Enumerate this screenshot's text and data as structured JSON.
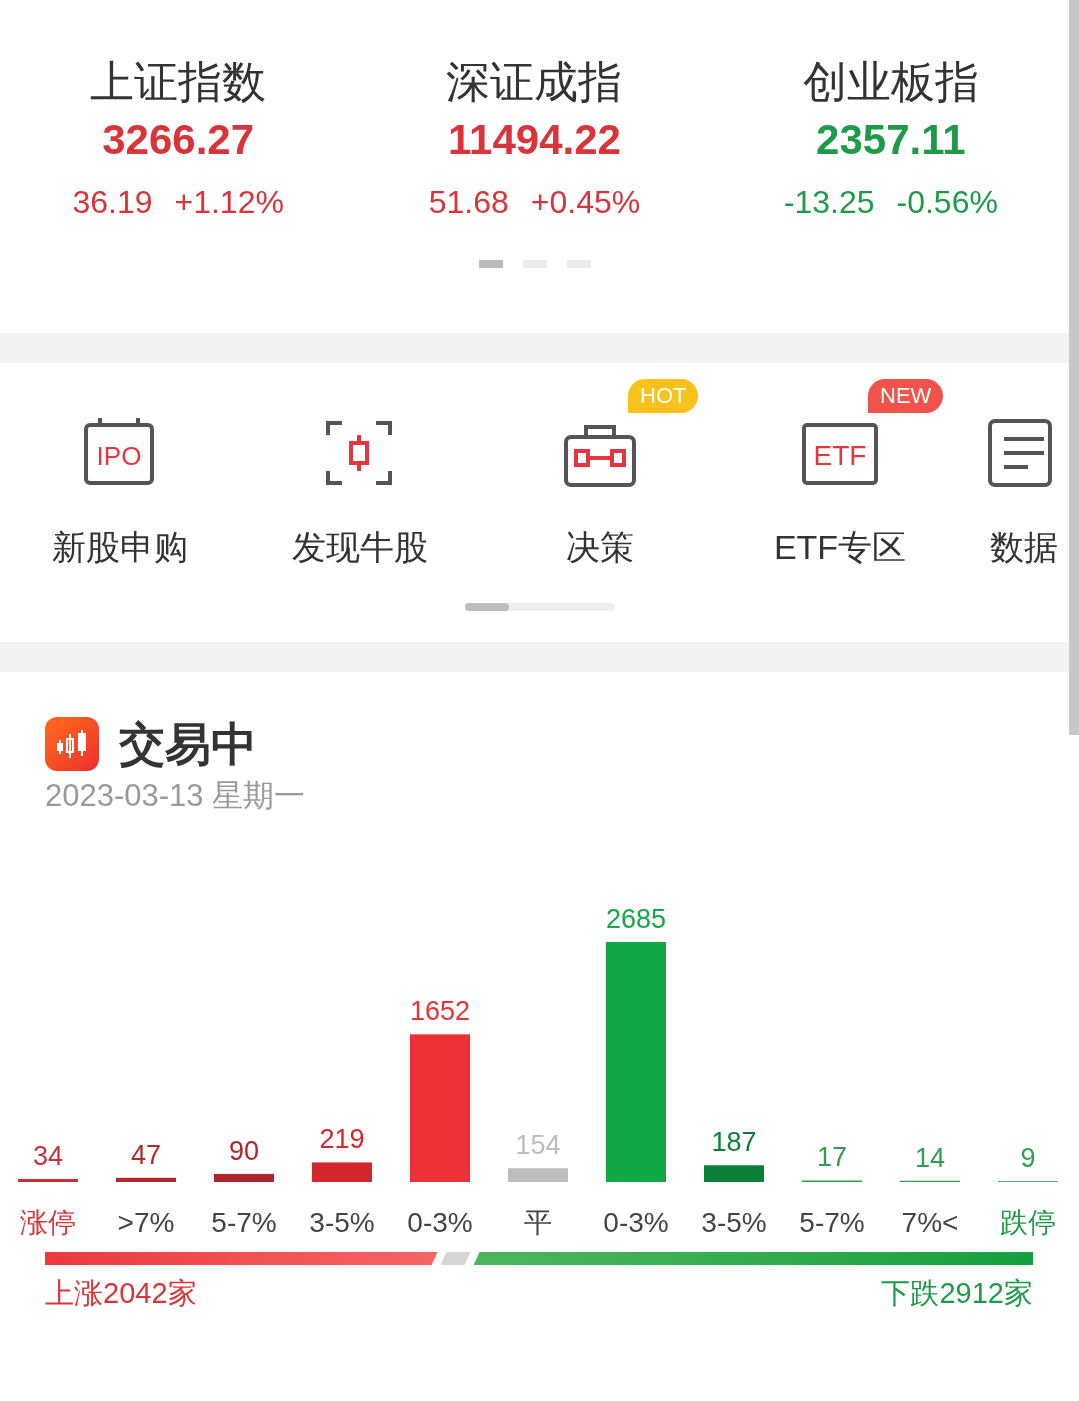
{
  "indices": [
    {
      "name": "上证指数",
      "value": "3266.27",
      "change": "36.19",
      "percent": "+1.12%",
      "color": "#d9343a"
    },
    {
      "name": "深证成指",
      "value": "11494.22",
      "change": "51.68",
      "percent": "+0.45%",
      "color": "#d9343a"
    },
    {
      "name": "创业板指",
      "value": "2357.11",
      "change": "-13.25",
      "percent": "-0.56%",
      "color": "#1e9b48"
    }
  ],
  "index_pager": [
    {
      "selected": true
    },
    {
      "selected": false
    },
    {
      "selected": false
    }
  ],
  "shortcuts": [
    {
      "label": "新股申购",
      "kind": "calendar",
      "icon_text": "IPO"
    },
    {
      "label": "发现牛股",
      "kind": "frame"
    },
    {
      "label": "决策",
      "kind": "toolbox",
      "badge": "HOT",
      "color": "#f8c21c"
    },
    {
      "label": "ETF专区",
      "kind": "box",
      "icon_text": "ETF",
      "badge": "NEW",
      "color": "#f0534b"
    },
    {
      "label": "数据",
      "kind": "document"
    }
  ],
  "trading": {
    "title": "交易中",
    "date": "2023-03-13 星期一",
    "chart_data": {
      "type": "bar",
      "categories": [
        "涨停",
        ">7%",
        "5-7%",
        "3-5%",
        "0-3%",
        "平",
        "0-3%",
        "3-5%",
        "5-7%",
        "7%<",
        "跌停"
      ],
      "series": [
        {
          "values": [
            34,
            47,
            90,
            219,
            1652,
            154,
            2685,
            187,
            17,
            14,
            9
          ]
        }
      ],
      "data_labels": true
    },
    "up_label": "上涨2042家",
    "down_label": "下跌2912家"
  }
}
